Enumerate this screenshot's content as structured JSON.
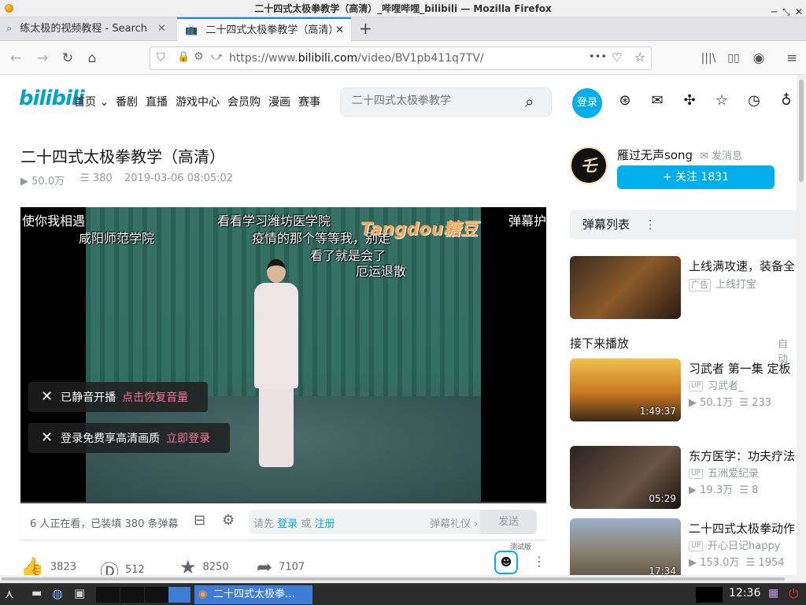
{
  "window": {
    "title": "二十四式太极拳教学（高清）_哔哩哔哩_bilibili — Mozilla Firefox"
  },
  "tabs": [
    {
      "label": "练太极的视频教程 - Search",
      "active": false
    },
    {
      "label": "二十四式太极拳教学（高清）",
      "active": true
    }
  ],
  "urlbar": {
    "url_prefix": "https://www.",
    "url_domain": "bilibili.com",
    "url_path": "/video/BV1pb411q7TV/",
    "more": "•••"
  },
  "site": {
    "logo": "bilibili",
    "nav": [
      "首页",
      "番剧",
      "直播",
      "游戏中心",
      "会员购",
      "漫画",
      "赛事"
    ],
    "search_placeholder": "二十四式太极拳教学",
    "login": "登录"
  },
  "video": {
    "title": "二十四式太极拳教学（高清）",
    "views": "50.0万",
    "danmaku_count": "380",
    "date": "2019-03-06 08:05:02"
  },
  "player": {
    "danmaku": [
      "使你我相遇",
      "咸阳师范学院",
      "看看学习潍坊医学院",
      "疫情的那个等等我，别走",
      "看了就是会了",
      "厄运退散",
      "弹幕护"
    ],
    "watermark": "Tangdou糖豆",
    "toast_mute": {
      "text": "已静音开播",
      "action": "点击恢复音量"
    },
    "toast_login": {
      "text": "登录免费享高清画质",
      "action": "立即登录"
    },
    "progress": 0.0
  },
  "sendbar": {
    "watching": "6 人正在看，已装填 380 条弹幕",
    "prompt_pre": "请先",
    "prompt_login": "登录",
    "prompt_or": "或",
    "prompt_register": "注册",
    "etiquette": "弹幕礼仪 ›",
    "send": "发送"
  },
  "actions": {
    "like": "3823",
    "coin": "512",
    "fav": "8250",
    "share": "7107",
    "beta": "测试版"
  },
  "uploader": {
    "name": "雁过无声song",
    "message": "发消息",
    "avatar_text": "乇",
    "follow": "+ 关注 1831"
  },
  "sidebar": {
    "danmu_list": "弹幕列表",
    "next_up": "接下来播放",
    "autoplay": "自动",
    "items": [
      {
        "title": "上线满攻速，装备全",
        "sub1": "广告",
        "sub2": "上线打宝",
        "duration": ""
      },
      {
        "title": "习武者 第一集 定板",
        "up": "习武者_",
        "views": "50.1万",
        "dm": "233",
        "duration": "1:49:37"
      },
      {
        "title": "东方医学：功夫疗法",
        "up": "五洲爱纪录",
        "views": "19.3万",
        "dm": "8",
        "duration": "05:29"
      },
      {
        "title": "二十四式太极拳动作",
        "up": "开心日记happy",
        "views": "153.0万",
        "dm": "1954",
        "duration": "17:34"
      }
    ]
  },
  "taskbar": {
    "task_label": "二十四式太极拳…",
    "clock": "12:36"
  }
}
